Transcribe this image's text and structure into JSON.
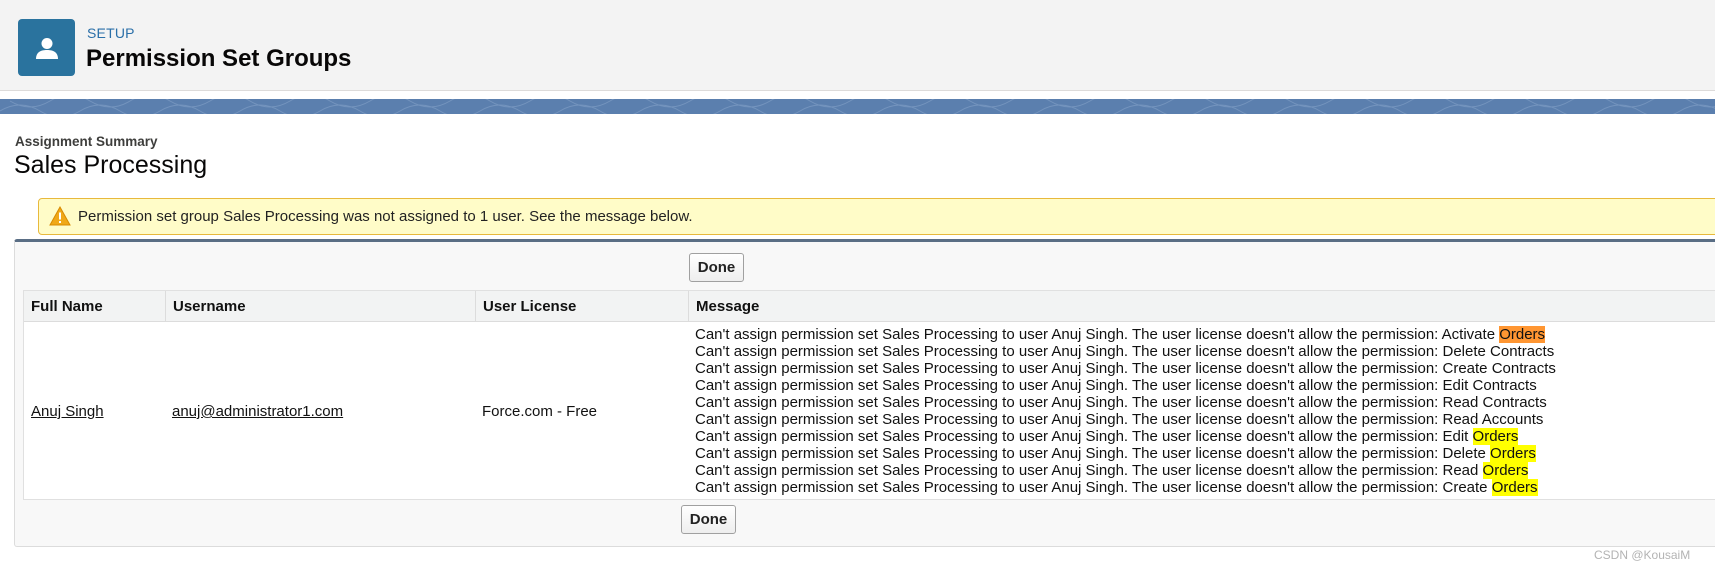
{
  "header": {
    "icon": "user-icon",
    "eyebrow": "SETUP",
    "title": "Permission Set Groups"
  },
  "summary": {
    "label": "Assignment Summary",
    "title": "Sales Processing"
  },
  "warning": {
    "icon": "warning-icon",
    "text": "Permission set group Sales Processing was not assigned to 1 user. See the message below."
  },
  "buttons": {
    "done_top": "Done",
    "done_bottom": "Done"
  },
  "table": {
    "headers": [
      "Full Name",
      "Username",
      "User License",
      "Message"
    ],
    "row": {
      "full_name": "Anuj Singh",
      "username": "anuj@administrator1.com",
      "license": "Force.com - Free"
    },
    "message_prefix": "Can't assign permission set Sales Processing to user Anuj Singh. The user license doesn't allow the permission: ",
    "messages": [
      {
        "action": "Activate ",
        "object": "Orders",
        "highlight": "orange"
      },
      {
        "action": "Delete Contracts",
        "object": "",
        "highlight": ""
      },
      {
        "action": "Create Contracts",
        "object": "",
        "highlight": ""
      },
      {
        "action": "Edit Contracts",
        "object": "",
        "highlight": ""
      },
      {
        "action": "Read Contracts",
        "object": "",
        "highlight": ""
      },
      {
        "action": "Read Accounts",
        "object": "",
        "highlight": ""
      },
      {
        "action": "Edit ",
        "object": "Orders",
        "highlight": "yellow"
      },
      {
        "action": "Delete ",
        "object": "Orders",
        "highlight": "yellow"
      },
      {
        "action": "Read ",
        "object": "Orders",
        "highlight": "yellow"
      },
      {
        "action": "Create ",
        "object": "Orders",
        "highlight": "yellow"
      }
    ]
  },
  "colors": {
    "brand_icon": "#2a739e",
    "highlight_orange": "#ff9632",
    "highlight_yellow": "#ffff00",
    "warning_bg": "#fffcc8"
  },
  "watermark": "CSDN @KousaiM"
}
